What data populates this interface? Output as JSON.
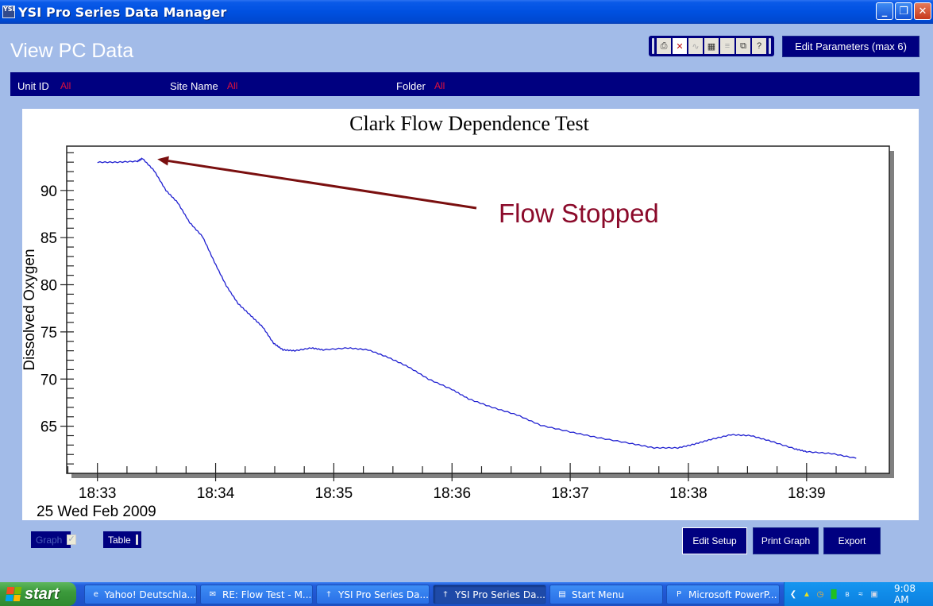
{
  "window": {
    "title": "YSI Pro Series Data Manager",
    "app_icon": "ysi-logo-icon",
    "controls": [
      "minimize",
      "restore",
      "close"
    ]
  },
  "page": {
    "title": "View PC Data"
  },
  "toolbar": {
    "icons": [
      {
        "name": "print-icon",
        "glyph": "⎙",
        "state": "enabled"
      },
      {
        "name": "zoom-off-icon",
        "glyph": "✕",
        "state": "active"
      },
      {
        "name": "graph-icon",
        "glyph": "∿",
        "state": "disabled"
      },
      {
        "name": "table-icon",
        "glyph": "▦",
        "state": "enabled"
      },
      {
        "name": "stats-icon",
        "glyph": "≡",
        "state": "disabled"
      },
      {
        "name": "copy-window-icon",
        "glyph": "⧉",
        "state": "enabled"
      },
      {
        "name": "help-icon",
        "glyph": "?",
        "state": "enabled"
      }
    ],
    "edit_parameters_label": "Edit Parameters (max 6)"
  },
  "filters": {
    "unit_id": {
      "label": "Unit ID",
      "value": "All"
    },
    "site_name": {
      "label": "Site Name",
      "value": "All"
    },
    "folder": {
      "label": "Folder",
      "value": "All"
    }
  },
  "chart_data": {
    "type": "line",
    "title": "Clark Flow Dependence Test",
    "xlabel": "",
    "ylabel": "Dissolved Oxygen",
    "date_label": "25 Wed Feb 2009",
    "x_unit": "minutes since 18:33",
    "xlim": [
      -0.26,
      6.7
    ],
    "ylim": [
      60.0,
      94.7
    ],
    "x_ticks": [
      0,
      1,
      2,
      3,
      4,
      5,
      6
    ],
    "x_tick_labels": [
      "18:33",
      "18:34",
      "18:35",
      "18:36",
      "18:37",
      "18:38",
      "18:39"
    ],
    "x_minor_step": 0.25,
    "y_ticks": [
      65,
      70,
      75,
      80,
      85,
      90
    ],
    "y_tick_labels": [
      "65",
      "70",
      "75",
      "80",
      "85",
      "90"
    ],
    "y_minor_step": 1,
    "grid": false,
    "series": [
      {
        "name": "Dissolved Oxygen",
        "color": "#1f1fd0",
        "x": [
          0.0,
          0.17,
          0.34,
          0.38,
          0.48,
          0.58,
          0.68,
          0.78,
          0.89,
          0.99,
          1.09,
          1.19,
          1.3,
          1.4,
          1.49,
          1.57,
          1.67,
          1.81,
          1.91,
          2.12,
          2.29,
          2.46,
          2.63,
          2.8,
          3.0,
          3.14,
          3.34,
          3.55,
          3.75,
          4.0,
          4.23,
          4.5,
          4.71,
          4.91,
          5.05,
          5.19,
          5.36,
          5.53,
          5.7,
          5.9,
          6.0,
          6.21,
          6.42
        ],
        "y": [
          93.0,
          93.0,
          93.1,
          93.4,
          92.1,
          90.0,
          88.7,
          86.6,
          85.1,
          82.4,
          79.9,
          78.0,
          76.7,
          75.5,
          73.8,
          73.1,
          73.0,
          73.3,
          73.1,
          73.3,
          73.1,
          72.3,
          71.3,
          70.0,
          68.9,
          67.9,
          67.0,
          66.2,
          65.1,
          64.4,
          63.8,
          63.2,
          62.7,
          62.7,
          63.1,
          63.6,
          64.1,
          64.0,
          63.4,
          62.6,
          62.3,
          62.1,
          61.6
        ]
      }
    ],
    "annotations": [
      {
        "text": "Flow Stopped",
        "color": "#8b0a2a",
        "arrow_color": "#7a0f0f",
        "arrow_target": {
          "x": 0.48,
          "y": 93.4
        }
      }
    ]
  },
  "view_options": {
    "graph": {
      "label": "Graph",
      "checked": true,
      "enabled": false
    },
    "table": {
      "label": "Table",
      "checked": false,
      "enabled": true
    }
  },
  "actions": {
    "edit_setup": "Edit Setup",
    "print_graph": "Print Graph",
    "export": "Export"
  },
  "taskbar": {
    "start_label": "start",
    "items": [
      {
        "label": "Yahoo! Deutschla...",
        "icon": "internet-explorer-icon",
        "glyph": "e",
        "active": false
      },
      {
        "label": "RE: Flow Test - M...",
        "icon": "mail-icon",
        "glyph": "✉",
        "active": false
      },
      {
        "label": "YSI Pro Series Da...",
        "icon": "ysi-logo-icon",
        "glyph": "†",
        "active": false
      },
      {
        "label": "YSI Pro Series Da...",
        "icon": "ysi-logo-icon",
        "glyph": "†",
        "active": true
      },
      {
        "label": "Start Menu",
        "icon": "folder-icon",
        "glyph": "▤",
        "active": false
      },
      {
        "label": "Microsoft PowerP...",
        "icon": "powerpoint-icon",
        "glyph": "P",
        "active": false
      }
    ],
    "tray_icons": [
      {
        "name": "expand-tray-icon",
        "glyph": "❮"
      },
      {
        "name": "lock-icon",
        "glyph": "▲"
      },
      {
        "name": "clock-app-icon",
        "glyph": "◷"
      },
      {
        "name": "meter-icon",
        "glyph": "█"
      },
      {
        "name": "bluetooth-icon",
        "glyph": "ʙ"
      },
      {
        "name": "wireless-icon",
        "glyph": "≈"
      },
      {
        "name": "network-icon",
        "glyph": "▣"
      }
    ],
    "clock": "9:08 AM"
  }
}
